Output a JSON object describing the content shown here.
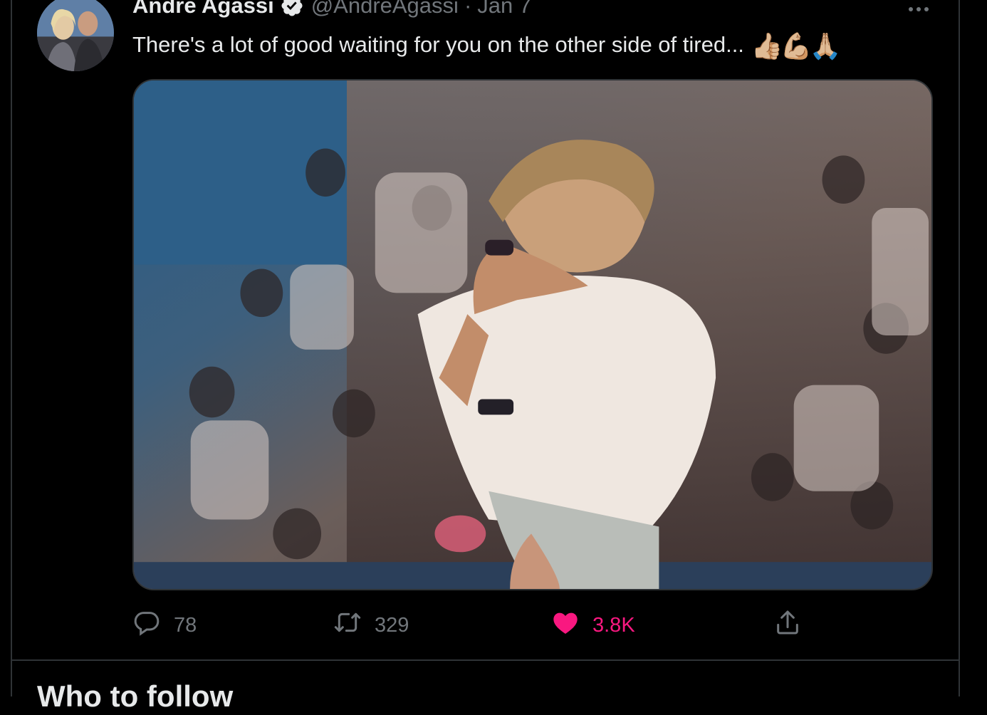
{
  "tweet": {
    "author_name": "Andre Agassi",
    "handle": "@AndreAgassi",
    "separator": "·",
    "date": "Jan 7",
    "text": "There's a lot of good waiting for you on the other side of tired...",
    "emojis": "👍🏼💪🏼🙏🏼",
    "media_description_icon": "photo"
  },
  "actions": {
    "reply_count": "78",
    "retweet_count": "329",
    "like_count": "3.8K",
    "liked": true
  },
  "sidebar_section": {
    "title": "Who to follow"
  },
  "colors": {
    "background": "#000000",
    "text_primary": "#e7e9ea",
    "text_secondary": "#71767b",
    "border": "#2f3336",
    "like_pink": "#f91880"
  },
  "icons": [
    "verified-badge-icon",
    "more-icon",
    "reply-icon",
    "retweet-icon",
    "heart-icon",
    "share-icon"
  ]
}
